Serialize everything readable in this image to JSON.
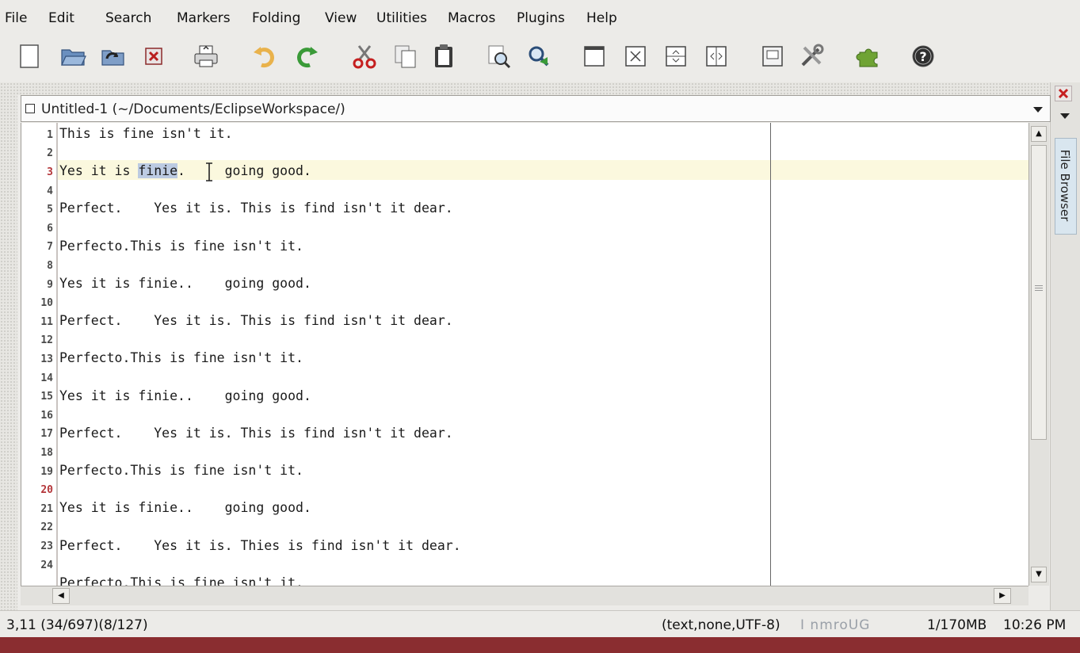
{
  "menu": [
    "File",
    "Edit",
    "Search",
    "Markers",
    "Folding",
    "View",
    "Utilities",
    "Macros",
    "Plugins",
    "Help"
  ],
  "buffer": {
    "title": "Untitled-1 (~/Documents/EclipseWorkspace/)"
  },
  "side_dock": {
    "label": "File Browser"
  },
  "editor": {
    "line_numbers": [
      "1",
      "2",
      "3",
      "4",
      "5",
      "6",
      "7",
      "8",
      "9",
      "10",
      "11",
      "12",
      "13",
      "14",
      "15",
      "16",
      "17",
      "18",
      "19",
      "20",
      "21",
      "22",
      "23",
      "24"
    ],
    "lines": {
      "l1": "This is fine isn't it.",
      "l3_pre": "Yes it is ",
      "l3_sel": "finie",
      "l3_post": ".     going good.",
      "l5": "Perfect.    Yes it is. This is find isn't it dear.",
      "l7": "Perfecto.This is fine isn't it.",
      "l9": "Yes it is finie..    going good.",
      "l11": "Perfect.    Yes it is. This is find isn't it dear.",
      "l13": "Perfecto.This is fine isn't it.",
      "l15": "Yes it is finie..    going good.",
      "l17": "Perfect.    Yes it is. This is find isn't it dear.",
      "l19": "Perfecto.This is fine isn't it.",
      "l21": "Yes it is finie..    going good.",
      "l23": "Perfect.    Yes it is. Thies is find isn't it dear.",
      "l25": "Perfecto.This is fine isn't it."
    }
  },
  "status": {
    "position": "3,11 (34/697)(8/127)",
    "mode": "(text,none,UTF-8)",
    "flags": "I nmroUG",
    "memory": "1/170MB",
    "time": "10:26 PM"
  }
}
